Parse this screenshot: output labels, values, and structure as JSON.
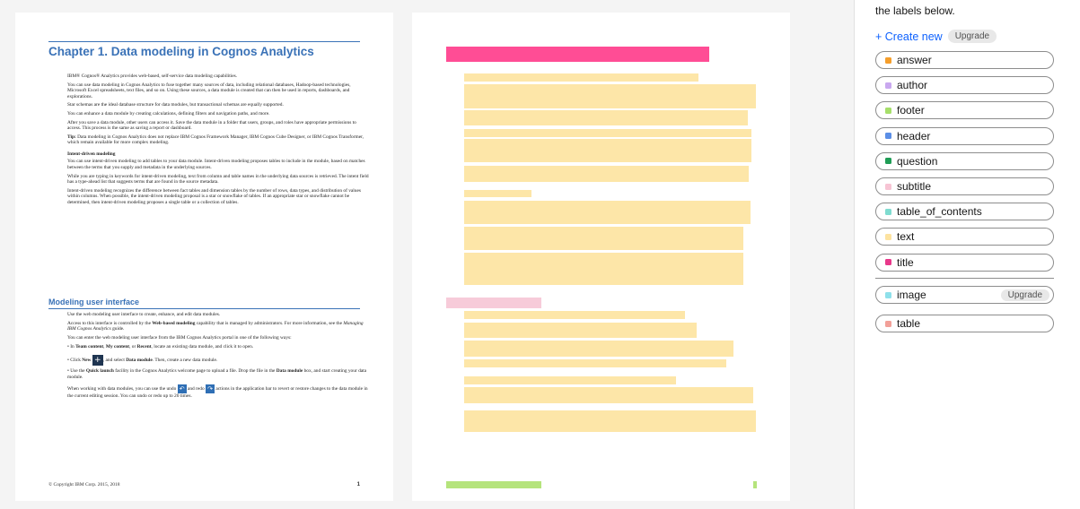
{
  "page1": {
    "chapter_title": "Chapter 1. Data modeling in Cognos Analytics",
    "paragraphs": [
      "IBM® Cognos® Analytics provides web-based, self-service data modeling capabilities.",
      "You can use data modeling in Cognos Analytics to fuse together many sources of data, including relational databases, Hadoop-based technologies, Microsoft Excel spreadsheets, text files, and so on. Using these sources, a data module is created that can then be used in reports, dashboards, and explorations.",
      "Star schemas are the ideal database structure for data modules, but transactional schemas are equally supported.",
      "You can enhance a data module by creating calculations, defining filters and navigation paths, and more.",
      "After you save a data module, other users can access it. Save the data module in a folder that users, groups, and roles have appropriate permissions to access. This process is the same as saving a report or dashboard."
    ],
    "tip_label": "Tip:",
    "tip_text": "Data modeling in Cognos Analytics does not replace IBM Cognos Framework Manager, IBM Cognos Cube Designer, or IBM Cognos Transformer, which remain available for more complex modeling.",
    "intent_heading": "Intent-driven modeling",
    "intent_paragraphs": [
      "You can use intent-driven modeling to add tables to your data module. Intent-driven modeling proposes tables to include in the module, based on matches between the terms that you supply and metadata in the underlying sources.",
      "While you are typing in keywords for intent-driven modeling, text from column and table names in the underlying data sources is retrieved. The intent field has a type-ahead list that suggests terms that are found in the source metadata.",
      "Intent-driven modeling recognizes the difference between fact tables and dimension tables by the number of rows, data types, and distribution of values within columns. When possible, the intent-driven modeling proposal is a star or snowflake of tables. If an appropriate star or snowflake cannot be determined, then intent-driven modeling proposes a single table or a collection of tables."
    ],
    "section_title": "Modeling user interface",
    "ui_intro": "Use the web modeling user interface to create, enhance, and edit data modules.",
    "access_pre": "Access to this interface is controlled by the ",
    "access_bold": "Web-based modeling",
    "access_mid": " capability that is managed by administrators. For more information, see the ",
    "access_italic": "Managing IBM Cognos Analytics",
    "access_post": " guide.",
    "portal_text": "You can enter the web modeling user interface from the IBM Cognos Analytics portal in one of the following ways:",
    "bullet1_pre": "• In ",
    "bullet1_b1": "Team content",
    "bullet1_c1": ", ",
    "bullet1_b2": "My content",
    "bullet1_c2": ", or ",
    "bullet1_b3": "Recent",
    "bullet1_post": ", locate an existing data module, and click it to open.",
    "bullet2_pre": "• Click ",
    "bullet2_b1": "New",
    "bullet2_mid": ", and select ",
    "bullet2_b2": "Data module",
    "bullet2_post": ". Then, create a new data module.",
    "bullet3_pre": "• Use the ",
    "bullet3_b1": "Quick launch",
    "bullet3_mid": " facility in the Cognos Analytics welcome page to upload a file. Drop the file in the ",
    "bullet3_b2": "Data module",
    "bullet3_post": " box, and start creating your data module.",
    "undo_pre": "When working with data modules, you can use the undo ",
    "undo_mid": " and redo ",
    "undo_post": " actions in the application bar to revert or restore changes to the data module in the current editing session. You can undo or redo up to 20 times.",
    "footer": "© Copyright IBM Corp. 2015, 2018",
    "page_number": "1",
    "new_icon_glyph": "+",
    "undo_icon_glyph": "↶",
    "redo_icon_glyph": "↷"
  },
  "panel": {
    "hint": "the labels below.",
    "create_new": "+ Create new",
    "upgrade": "Upgrade",
    "labels": [
      {
        "name": "answer",
        "color": "#f59e2b"
      },
      {
        "name": "author",
        "color": "#c9a8ef"
      },
      {
        "name": "footer",
        "color": "#a6df6a"
      },
      {
        "name": "header",
        "color": "#5b8ee6"
      },
      {
        "name": "question",
        "color": "#1f9d55"
      },
      {
        "name": "subtitle",
        "color": "#f7c4d4"
      },
      {
        "name": "table_of_contents",
        "color": "#7fdcd0"
      },
      {
        "name": "text",
        "color": "#fde3a0"
      },
      {
        "name": "title",
        "color": "#e8388a"
      }
    ],
    "extra_labels": [
      {
        "name": "image",
        "color": "#8ee0ea",
        "upgrade": "Upgrade"
      },
      {
        "name": "table",
        "color": "#f2a099"
      }
    ]
  },
  "annotation_colors": {
    "title": "#ff4d95",
    "text": "#fde6a8",
    "subtitle": "#f7cbd9",
    "footer": "#b5e47c"
  }
}
